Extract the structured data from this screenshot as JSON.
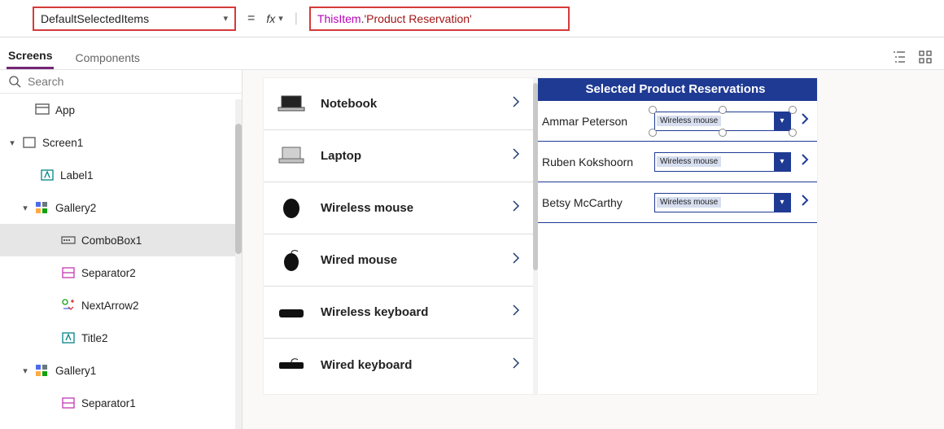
{
  "formula": {
    "property": "DefaultSelectedItems",
    "equals": "=",
    "fx": "fx",
    "token_this": "ThisItem",
    "token_dot": ".",
    "token_str": "'Product Reservation'"
  },
  "tabs": {
    "screens": "Screens",
    "components": "Components"
  },
  "search": {
    "placeholder": "Search"
  },
  "tree": {
    "app": "App",
    "screen1": "Screen1",
    "label1": "Label1",
    "gallery2": "Gallery2",
    "combobox1": "ComboBox1",
    "separator2": "Separator2",
    "nextarrow2": "NextArrow2",
    "title2": "Title2",
    "gallery1": "Gallery1",
    "separator1": "Separator1"
  },
  "products": [
    {
      "name": "Notebook"
    },
    {
      "name": "Laptop"
    },
    {
      "name": "Wireless mouse"
    },
    {
      "name": "Wired mouse"
    },
    {
      "name": "Wireless keyboard"
    },
    {
      "name": "Wired keyboard"
    }
  ],
  "reservations": {
    "header": "Selected Product Reservations",
    "rows": [
      {
        "name": "Ammar Peterson",
        "value": "Wireless mouse"
      },
      {
        "name": "Ruben Kokshoorn",
        "value": "Wireless mouse"
      },
      {
        "name": "Betsy McCarthy",
        "value": "Wireless mouse"
      }
    ]
  }
}
